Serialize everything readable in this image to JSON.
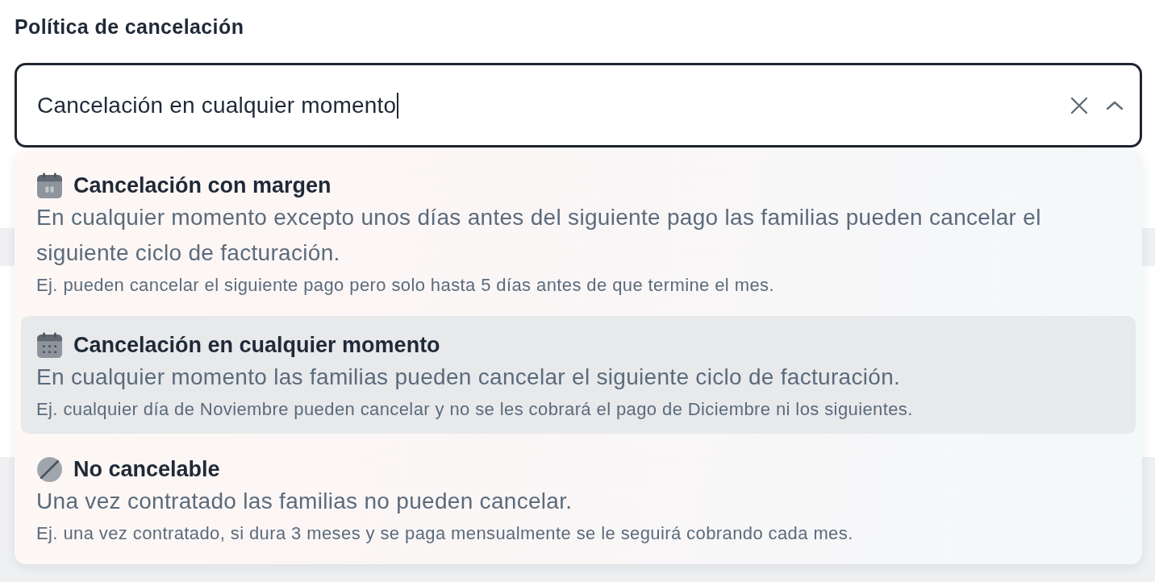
{
  "field": {
    "label": "Política de cancelación",
    "value": "Cancelación en cualquier momento",
    "focused": true,
    "expanded": true,
    "clearable": true
  },
  "options": [
    {
      "kind": "margin",
      "title": "Cancelación con margen",
      "description": "En cualquier momento excepto unos días antes del siguiente pago las familias pueden cancelar el siguiente ciclo de facturación.",
      "example": "Ej. pueden cancelar el siguiente pago pero solo hasta 5 días antes de que termine el mes.",
      "selected": false
    },
    {
      "kind": "anytime",
      "title": "Cancelación en cualquier momento",
      "description": "En cualquier momento las familias pueden cancelar el siguiente ciclo de facturación.",
      "example": "Ej. cualquier día de Noviembre pueden cancelar y no se les cobrará el pago de Diciembre ni los siguientes.",
      "selected": true
    },
    {
      "kind": "blocked",
      "title": "No cancelable",
      "description": "Una vez contratado las familias no pueden cancelar.",
      "example": "Ej. una vez contratado, si dura 3 meses y se paga mensualmente se le seguirá cobrando cada mes.",
      "selected": false
    }
  ]
}
